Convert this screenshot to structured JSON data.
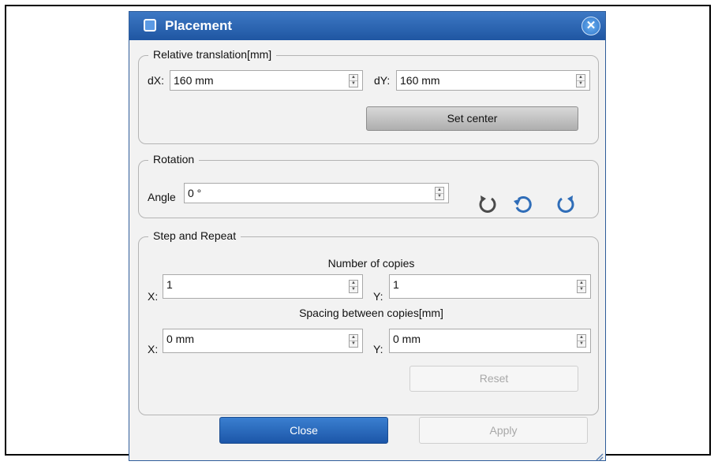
{
  "dialog": {
    "title": "Placement",
    "close_glyph": "✕"
  },
  "relative_translation": {
    "legend": "Relative translation[mm]",
    "dx_label": "dX:",
    "dx_value": "160 mm",
    "dy_label": "dY:",
    "dy_value": "160 mm",
    "set_center_label": "Set center"
  },
  "rotation": {
    "legend": "Rotation",
    "angle_label": "Angle",
    "angle_value": "0 °",
    "icons": [
      "rotate-counterclockwise-icon",
      "rotate-reset-icon",
      "rotate-clockwise-icon"
    ]
  },
  "step_repeat": {
    "legend": "Step and Repeat",
    "copies_heading": "Number of copies",
    "copies_x_label": "X:",
    "copies_x_value": "1",
    "copies_y_label": "Y:",
    "copies_y_value": "1",
    "spacing_heading": "Spacing between copies[mm]",
    "spacing_x_label": "X:",
    "spacing_x_value": "0 mm",
    "spacing_y_label": "Y:",
    "spacing_y_value": "0 mm",
    "reset_label": "Reset"
  },
  "footer": {
    "close_label": "Close",
    "apply_label": "Apply"
  },
  "spin": {
    "up": "▲",
    "down": "▼"
  },
  "colors": {
    "title_bar": "#1f56a2",
    "accent": "#2d74c9",
    "rotate_icon": "#4a4a4a"
  }
}
